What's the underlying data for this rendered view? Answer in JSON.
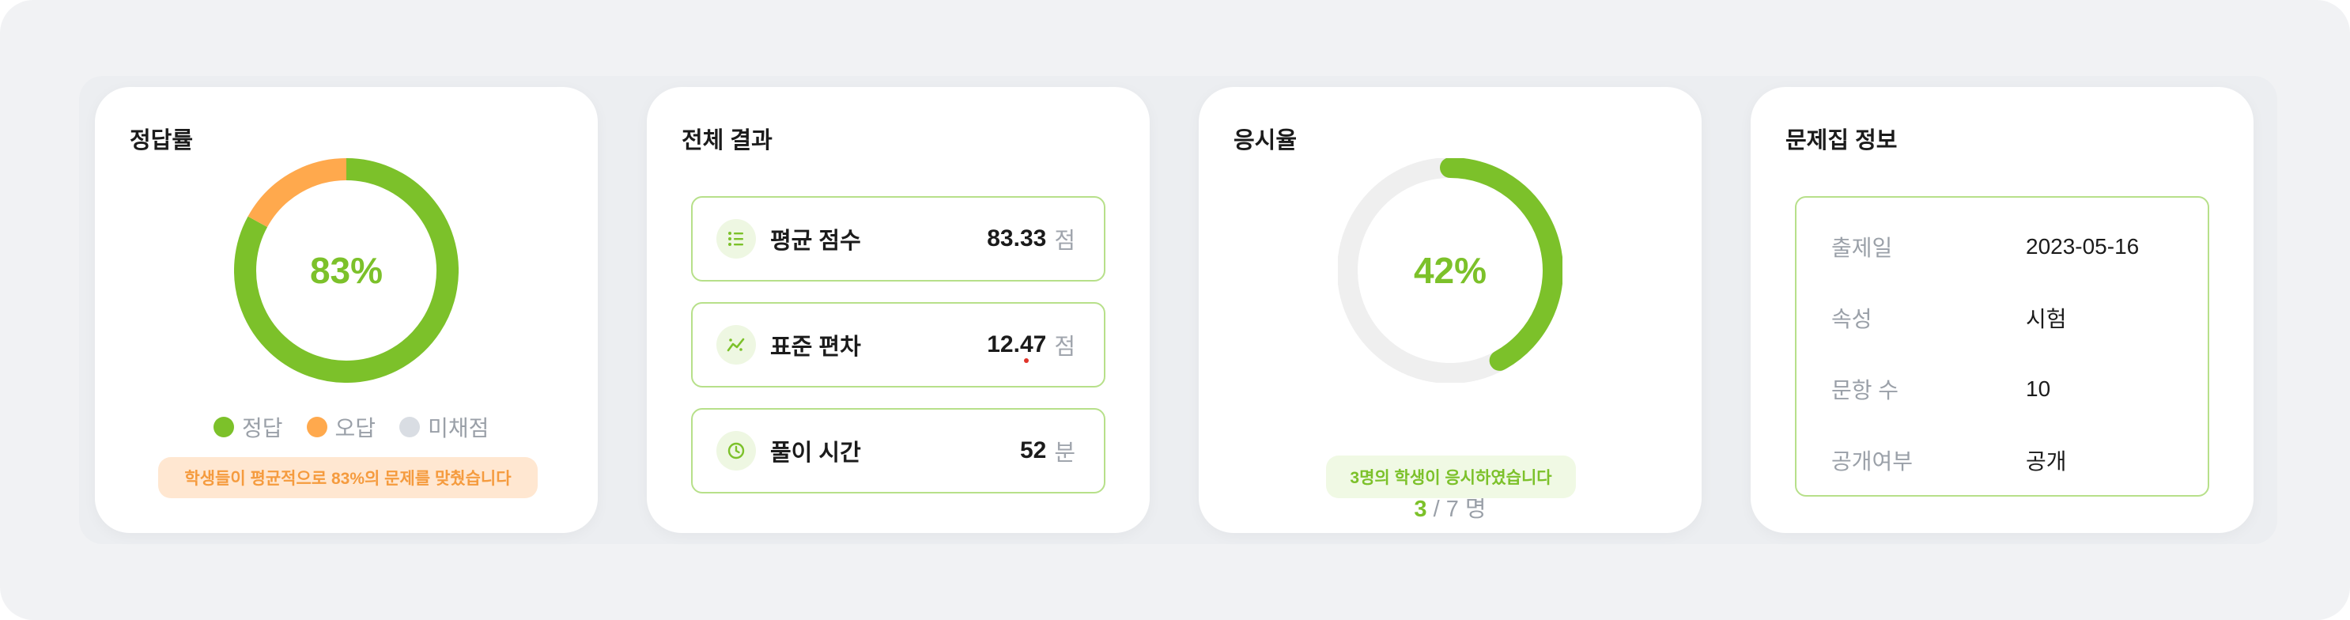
{
  "colors": {
    "accent_green": "#7cc12a",
    "orange": "#ffa94d",
    "unscored_gray": "#d9dde3",
    "track_gray": "#efefef",
    "border_green": "#b7e08a"
  },
  "accuracy_card": {
    "title": "정답률",
    "center_label": "83%",
    "legend": [
      {
        "label": "정답",
        "color": "#7cc12a"
      },
      {
        "label": "오답",
        "color": "#ffa94d"
      },
      {
        "label": "미채점",
        "color": "#d9dde3"
      }
    ],
    "note": "학생들이 평균적으로 83%의 문제를 맞췄습니다",
    "chart_data": {
      "type": "pie",
      "categories": [
        "정답",
        "오답",
        "미채점"
      ],
      "values": [
        83,
        17,
        0
      ]
    }
  },
  "overall_card": {
    "title": "전체 결과",
    "stats": [
      {
        "icon": "list-icon",
        "label": "평균 점수",
        "value": "83.33",
        "unit": "점"
      },
      {
        "icon": "trend-chart-icon",
        "label": "표준 편차",
        "value": "12.47",
        "unit": "점"
      },
      {
        "icon": "clock-icon",
        "label": "풀이 시간",
        "value": "52",
        "unit": "분"
      }
    ]
  },
  "participation_card": {
    "title": "응시율",
    "center_label": "42%",
    "taken": "3",
    "separator": " / 7 명",
    "note": "3명의 학생이 응시하였습니다",
    "progress": 0.42
  },
  "info_card": {
    "title": "문제집 정보",
    "rows": [
      {
        "key": "출제일",
        "value": "2023-05-16"
      },
      {
        "key": "속성",
        "value": "시험"
      },
      {
        "key": "문항 수",
        "value": "10"
      },
      {
        "key": "공개여부",
        "value": "공개"
      }
    ]
  }
}
